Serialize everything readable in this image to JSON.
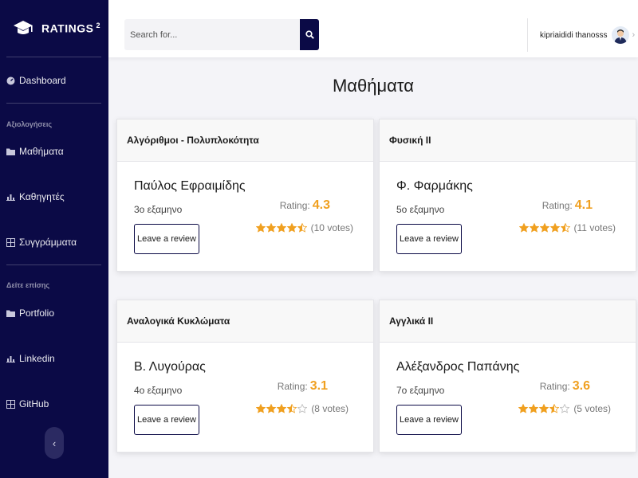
{
  "brand": {
    "name": "RATINGS",
    "sup": "2"
  },
  "sidebar": {
    "dashboard": "Dashboard",
    "section1": "Αξιολογήσεις",
    "items1": [
      {
        "label": "Μαθήματα",
        "icon": "folder-icon"
      },
      {
        "label": "Καθηγητές",
        "icon": "chart-icon"
      },
      {
        "label": "Συγγράμματα",
        "icon": "table-icon"
      }
    ],
    "section2": "Δείτε επίσης",
    "items2": [
      {
        "label": "Portfolio",
        "icon": "folder-icon"
      },
      {
        "label": "Linkedin",
        "icon": "chart-icon"
      },
      {
        "label": "GitHub",
        "icon": "table-icon"
      }
    ],
    "toggle": "‹"
  },
  "topbar": {
    "search_placeholder": "Search for...",
    "username": "kipriaididi thanosss"
  },
  "main": {
    "title": "Μαθήματα",
    "review_label": "Leave a review",
    "rating_label": "Rating:",
    "cards": [
      {
        "course": "Αλγόριθμοι - Πολυπλοκότητα",
        "professor": "Παύλος Εφραιμίδης",
        "semester": "3ο εξαμηνο",
        "rating": "4.3",
        "stars": 4.5,
        "votes": "(10 votes)"
      },
      {
        "course": "Φυσική ΙΙ",
        "professor": "Φ. Φαρμάκης",
        "semester": "5ο εξαμηνο",
        "rating": "4.1",
        "stars": 4.5,
        "votes": "(11 votes)"
      },
      {
        "course": "Αναλογικά Κυκλώματα",
        "professor": "Β. Λυγούρας",
        "semester": "4ο εξαμηνο",
        "rating": "3.1",
        "stars": 3.5,
        "votes": "(8 votes)"
      },
      {
        "course": "Αγγλικά ΙΙ",
        "professor": "Αλέξανδρος Παπάνης",
        "semester": "7ο εξαμηνο",
        "rating": "3.6",
        "stars": 3.5,
        "votes": "(5 votes)"
      }
    ]
  },
  "colors": {
    "sidebar": "#0b0a46",
    "accent": "#f0a020"
  }
}
